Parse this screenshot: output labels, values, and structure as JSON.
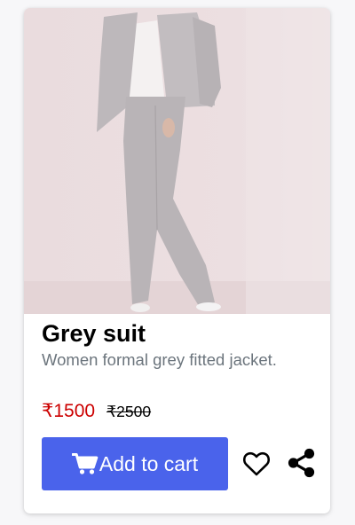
{
  "product": {
    "title": "Grey suit",
    "description": "Women formal grey fitted jacket.",
    "price": "₹1500",
    "original_price": "₹2500",
    "image_subject": "woman in grey formal suit"
  },
  "actions": {
    "add_to_cart_label": "Add to cart",
    "cart_icon": "shopping-cart-icon",
    "wishlist_icon": "heart-outline-icon",
    "share_icon": "share-icon"
  },
  "colors": {
    "accent": "#4a63eb",
    "price": "#cc0000",
    "muted_text": "#6c757d"
  }
}
